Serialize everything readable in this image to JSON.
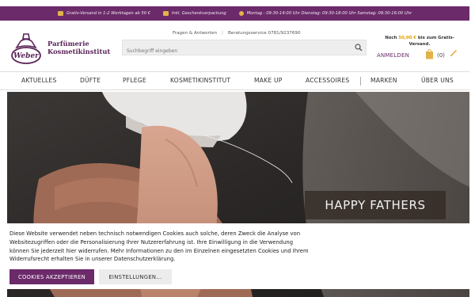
{
  "infobar": {
    "items": [
      {
        "icon": "truck-icon",
        "text": "Gratis-Versand in 1-2 Werktagen ab 50 €"
      },
      {
        "icon": "gift-icon",
        "text": "Inkl. Geschenkverpackung"
      },
      {
        "icon": "clock-icon",
        "text": "Montag : 09:30-14:00 Uhr Dienstag: 09:30-18:00 Uhr  Samstag: 09:30-16:00 Uhr"
      }
    ]
  },
  "header": {
    "logo_text": "Weber",
    "brand_line1": "Parfümerie",
    "brand_line2": "Kosmetikinstitut",
    "links": [
      "Fragen & Antworten",
      "Beratungsservice 0781/9237690"
    ],
    "search_placeholder": "Suchbegriff eingeben",
    "ship_prefix": "Noch",
    "ship_amount": "50,00 €",
    "ship_suffix": "bis zum Gratis-Versand.",
    "login_label": "ANMELDEN",
    "cart_count": "(0)"
  },
  "nav": {
    "items": [
      "AKTUELLES",
      "DÜFTE",
      "PFLEGE",
      "KOSMETIKINSTITUT",
      "MAKE UP",
      "ACCESSOIRES",
      "MARKEN",
      "ÜBER UNS"
    ]
  },
  "hero": {
    "caption": "HAPPY FATHERS"
  },
  "cookie": {
    "text": "Diese Website verwendet neben technisch notwendigen Cookies auch solche, deren Zweck die Analyse von Websitezugriffen oder die Personalisierung Ihrer Nutzererfahrung ist. Ihre Einwilligung in die Verwendung können Sie jederzeit hier widerrufen. Mehr Informationen zu den im Einzelnen eingesetzten Cookies und Ihrem Widerrufsrecht erhalten Sie in unserer Datenschutzerklärung.",
    "accept_label": "COOKIES AKZEPTIEREN",
    "settings_label": "EINSTELLUNGEN..."
  },
  "colors": {
    "brand": "#6b2a6a",
    "accent": "#e3b24a"
  }
}
